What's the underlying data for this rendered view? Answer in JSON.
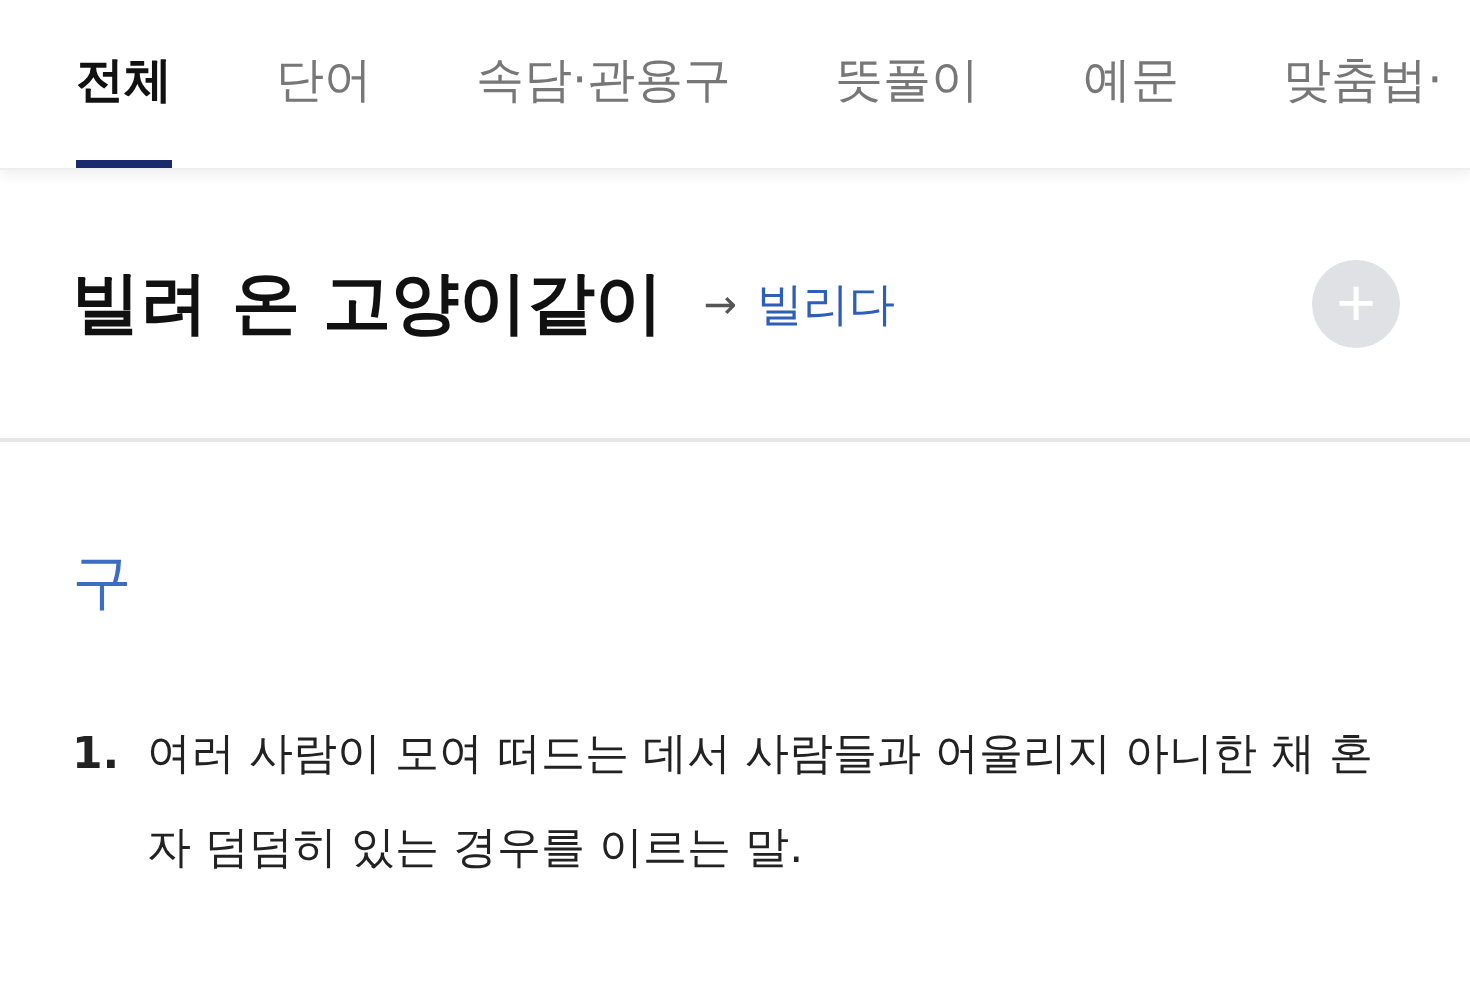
{
  "tabs": [
    {
      "label": "전체",
      "selected": true
    },
    {
      "label": "단어",
      "selected": false
    },
    {
      "label": "속담·관용구",
      "selected": false
    },
    {
      "label": "뜻풀이",
      "selected": false
    },
    {
      "label": "예문",
      "selected": false
    },
    {
      "label": "맞춤법·",
      "selected": false
    }
  ],
  "entry": {
    "headword": "빌려 온 고양이같이",
    "arrow": "→",
    "link": "빌리다",
    "add_button": "+"
  },
  "section": {
    "label": "구",
    "definitions": [
      {
        "number": "1.",
        "text": "여러 사람이 모여 떠드는 데서 사람들과 어울리지 아니한 채 혼자 덤덤히 있는 경우를 이르는 말."
      }
    ]
  }
}
